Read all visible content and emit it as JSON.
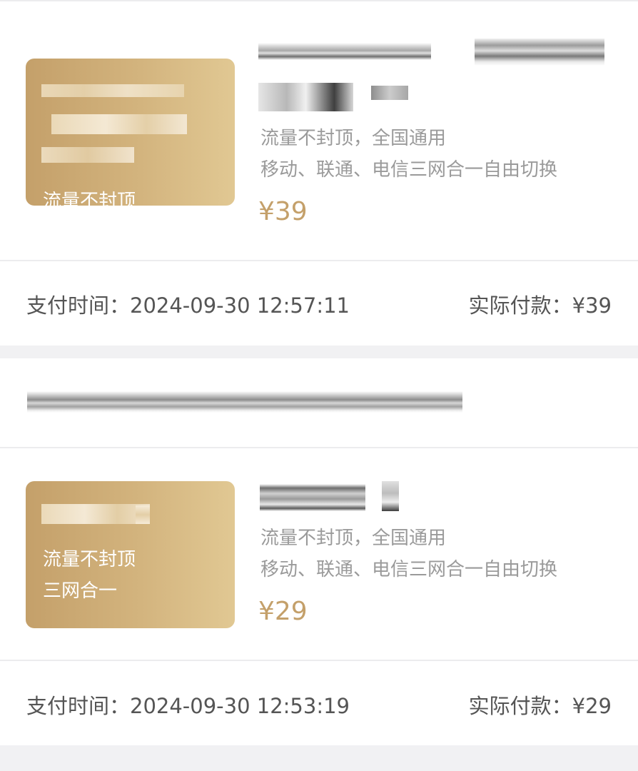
{
  "orders": [
    {
      "card_texts": [
        "流量不封顶"
      ],
      "desc_line1": "流量不封顶，全国通用",
      "desc_line2": "移动、联通、电信三网合一自由切换",
      "price": "¥39",
      "pay_time": "支付时间：2024-09-30 12:57:11",
      "paid": "实际付款：¥39"
    },
    {
      "card_texts": [
        "流量不封顶",
        "三网合一"
      ],
      "desc_line1": "流量不封顶，全国通用",
      "desc_line2": "移动、联通、电信三网合一自由切换",
      "price": "¥29",
      "pay_time": "支付时间：2024-09-30 12:53:19",
      "paid": "实际付款：¥29"
    }
  ],
  "colors": {
    "accent": "#c4a06a",
    "background": "#f1f1f3",
    "card": "#ffffff",
    "muted_text": "#9a9a9a"
  }
}
